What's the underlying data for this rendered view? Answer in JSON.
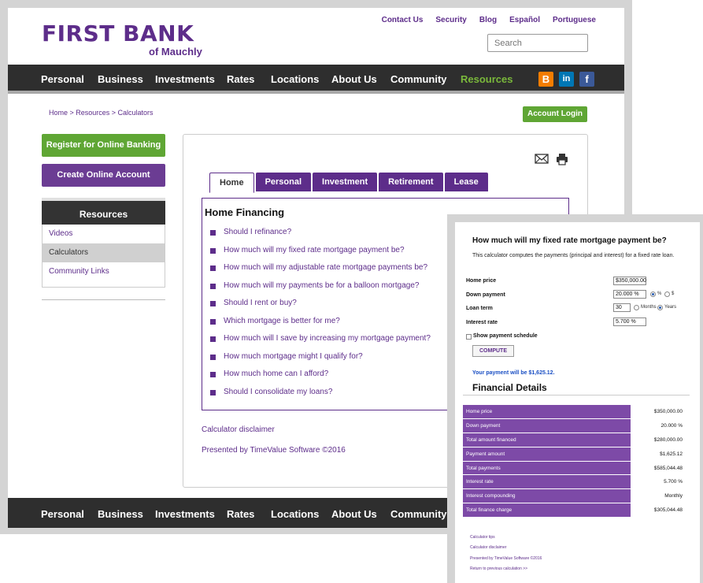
{
  "brand": {
    "name": "FIRST BANK",
    "tagline": "of Mauchly",
    "color": "#5d2d8a"
  },
  "util_nav": [
    "Contact Us",
    "Security",
    "Blog",
    "Español",
    "Portuguese"
  ],
  "search": {
    "placeholder": "Search"
  },
  "main_nav": [
    "Personal",
    "Business",
    "Investments",
    "Rates",
    "Locations",
    "About Us",
    "Community",
    "Resources"
  ],
  "main_nav_active": "Resources",
  "social": [
    "blogger-icon",
    "linkedin-icon",
    "facebook-icon"
  ],
  "breadcrumb": "Home > Resources > Calculators",
  "account_login": "Account Login",
  "sidebar": {
    "register": "Register for Online Banking",
    "create": "Create Online Account",
    "resources_title": "Resources",
    "items": [
      "Videos",
      "Calculators",
      "Community Links"
    ],
    "selected": "Calculators"
  },
  "calc_tabs": [
    "Home",
    "Personal",
    "Investment",
    "Retirement",
    "Lease"
  ],
  "calc_tabs_active": "Home",
  "home_financing": {
    "title": "Home Financing",
    "questions": [
      "Should I refinance?",
      "How much will my fixed rate mortgage payment be?",
      "How much will my adjustable rate mortgage payments be?",
      "How much will my payments be for a balloon mortgage?",
      "Should I rent or buy?",
      "Which mortgage is better for me?",
      "How much will I save by increasing my mortgage payment?",
      "How much mortgage might I qualify for?",
      "How much home can I afford?",
      "Should I consolidate my loans?"
    ]
  },
  "calculator_disclaimer": "Calculator disclaimer",
  "presented_by": "Presented by TimeValue Software ©2016",
  "bottom_nav": [
    "Personal",
    "Business",
    "Investments",
    "Rates",
    "Locations",
    "About Us",
    "Community"
  ],
  "calculator": {
    "title": "How much will my fixed rate mortgage payment be?",
    "description": "This calculator computes the payments (principal and interest) for a fixed rate loan.",
    "fields": {
      "home_price": {
        "label": "Home price",
        "value": "$350,000.00"
      },
      "down_payment": {
        "label": "Down payment",
        "value": "20.000 %",
        "opt_percent": "%",
        "opt_dollar": "$"
      },
      "loan_term": {
        "label": "Loan term",
        "value": "30",
        "opt_months": "Months",
        "opt_years": "Years"
      },
      "interest_rate": {
        "label": "Interest rate",
        "value": "5.700 %"
      }
    },
    "show_schedule": "Show payment schedule",
    "compute": "COMPUTE",
    "result": "Your payment will be $1,625.12.",
    "financial_details_title": "Financial Details",
    "details": [
      {
        "label": "Home price",
        "value": "$350,000.00"
      },
      {
        "label": "Down payment",
        "value": "20.000 %"
      },
      {
        "label": "Total amount financed",
        "value": "$280,000.00"
      },
      {
        "label": "Payment amount",
        "value": "$1,625.12"
      },
      {
        "label": "Total payments",
        "value": "$585,044.48"
      },
      {
        "label": "Interest rate",
        "value": "5.700 %"
      },
      {
        "label": "Interest compounding",
        "value": "Monthly"
      },
      {
        "label": "Total finance charge",
        "value": "$305,044.48"
      }
    ],
    "links": [
      "Calculator tips",
      "Calculator disclaimer",
      "Presented by TimeValue Software ©2016",
      "Return to previous calculation >>"
    ]
  }
}
